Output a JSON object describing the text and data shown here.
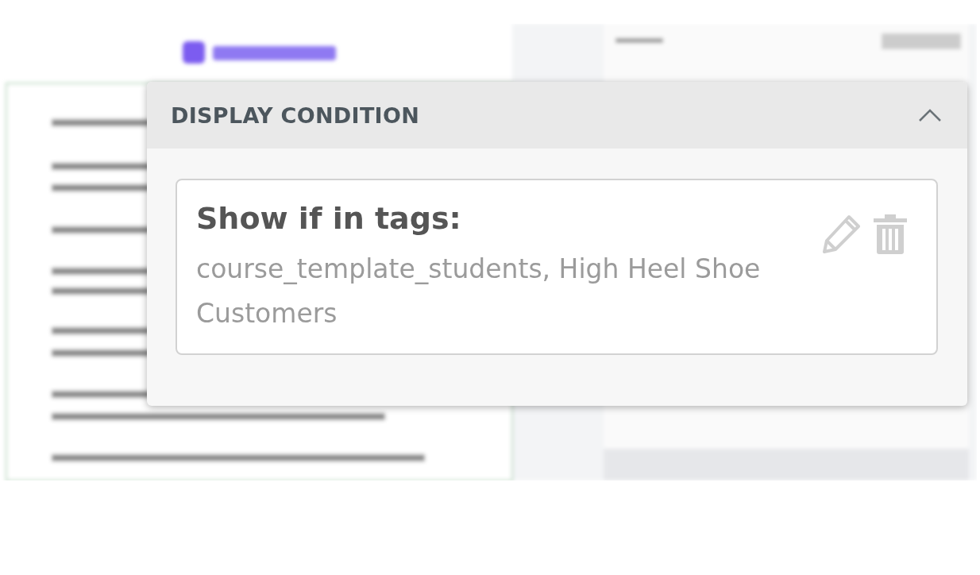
{
  "panel": {
    "title": "DISPLAY CONDITION",
    "expanded": true
  },
  "condition": {
    "label": "Show if in tags:",
    "value": "course_template_students, High Heel Shoe Customers"
  }
}
